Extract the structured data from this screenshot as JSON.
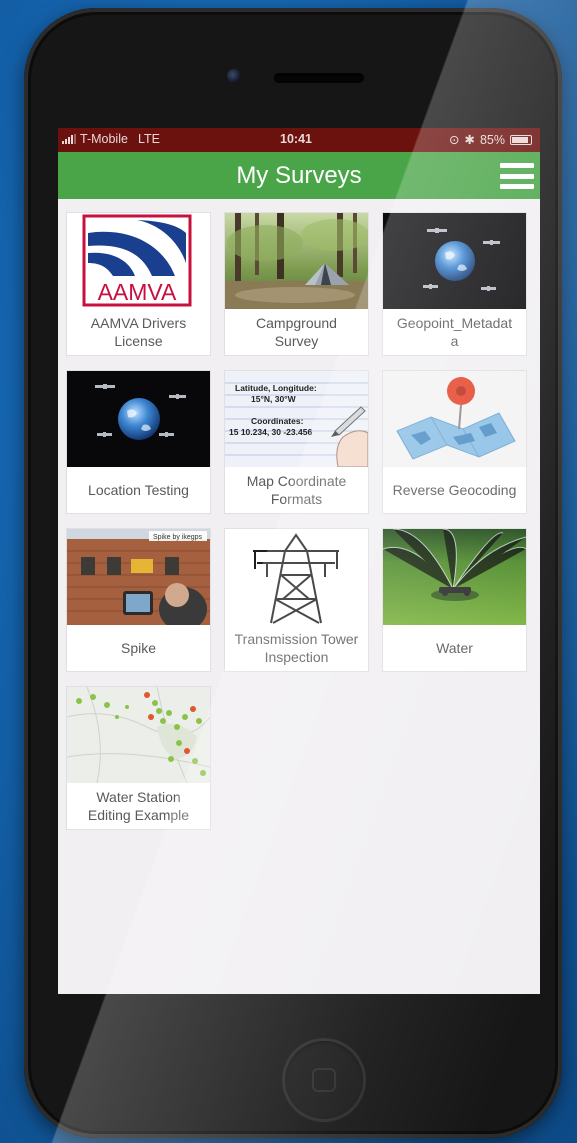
{
  "status_bar": {
    "carrier": "T-Mobile",
    "network": "LTE",
    "time": "10:41",
    "battery": "85%",
    "background_color": "#6b120f"
  },
  "header": {
    "title": "My Surveys",
    "menu_icon": "hamburger-menu-icon",
    "background_color": "#4aa548"
  },
  "surveys": [
    {
      "label_lines": [
        "AAMVA Drivers",
        "License"
      ],
      "thumbnail": "aamva-logo-icon"
    },
    {
      "label_lines": [
        "Campground",
        "Survey"
      ],
      "thumbnail": "campground-tent-photo"
    },
    {
      "label_lines": [
        "Geopoint_Metadat",
        "a"
      ],
      "thumbnail": "earth-satellites-photo"
    },
    {
      "label_lines": [
        "Location Testing"
      ],
      "thumbnail": "earth-satellites-photo"
    },
    {
      "label_lines": [
        "Map Coordinate",
        "Formats"
      ],
      "thumbnail": "coordinates-notebook-image"
    },
    {
      "label_lines": [
        "Reverse Geocoding"
      ],
      "thumbnail": "map-pin-icon"
    },
    {
      "label_lines": [
        "Spike"
      ],
      "thumbnail": "spike-device-photo"
    },
    {
      "label_lines": [
        "Transmission Tower",
        "Inspection"
      ],
      "thumbnail": "transmission-tower-icon"
    },
    {
      "label_lines": [
        "Water"
      ],
      "thumbnail": "sprinkler-lawn-photo"
    },
    {
      "label_lines": [
        "Water Station",
        "Editing Example"
      ],
      "thumbnail": "station-map-image"
    }
  ],
  "thumbnail_text": {
    "aamva": "AAMVA",
    "coords_latlong": "Latitude, Longitude:",
    "coords_dms": "15°N, 30°W",
    "coords_title": "Coordinates:",
    "coords_values": "15 10.234, 30 -23.456",
    "spike_brand": "Spike by ikegps"
  }
}
